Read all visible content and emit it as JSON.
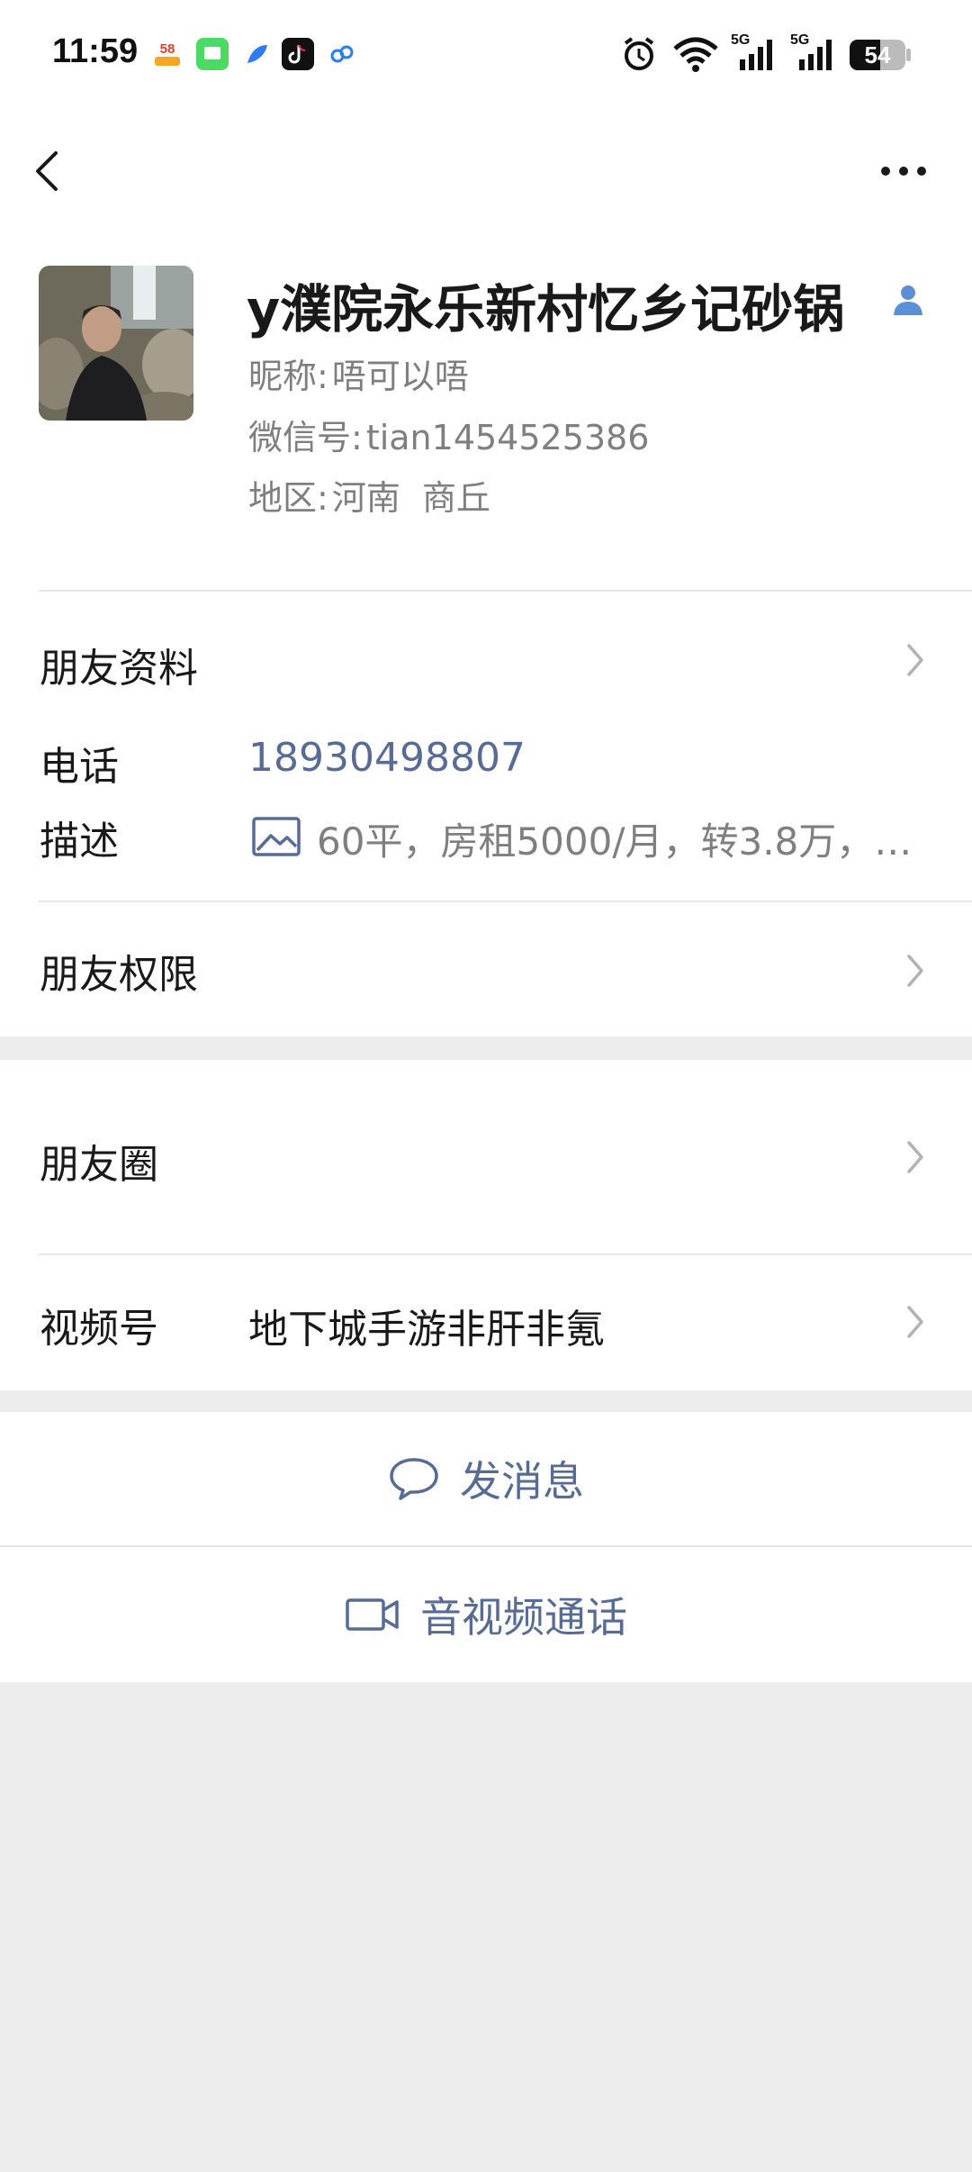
{
  "status_bar": {
    "time": "11:59",
    "app_icons": [
      "58-app-icon",
      "messages-app-icon",
      "feather-app-icon",
      "tiktok-app-icon",
      "link-app-icon"
    ],
    "network_1": "5G",
    "network_2": "5G",
    "battery": "54"
  },
  "nav": {
    "back_icon": "chevron-left-icon",
    "more_icon": "ellipsis-icon"
  },
  "profile": {
    "name": "y濮院永乐新村忆乡记砂锅",
    "nickname_label": "昵称:",
    "nickname": "唔可以唔",
    "wechat_id_label": "微信号:",
    "wechat_id": "tian1454525386",
    "region_label": "地区:",
    "region": "河南  商丘"
  },
  "details": {
    "friend_profile_label": "朋友资料",
    "phone_label": "电话",
    "phone_value": "18930498807",
    "description_label": "描述",
    "description_value": "60平，房租5000/月，转3.8万，…",
    "friend_permissions_label": "朋友权限"
  },
  "social": {
    "moments_label": "朋友圈",
    "channels_label": "视频号",
    "channels_value": "地下城手游非肝非氪"
  },
  "actions": {
    "message_label": "发消息",
    "call_label": "音视频通话"
  },
  "colors": {
    "link": "#576b95",
    "background": "#ededed",
    "muted_text": "#7f7f7f"
  }
}
